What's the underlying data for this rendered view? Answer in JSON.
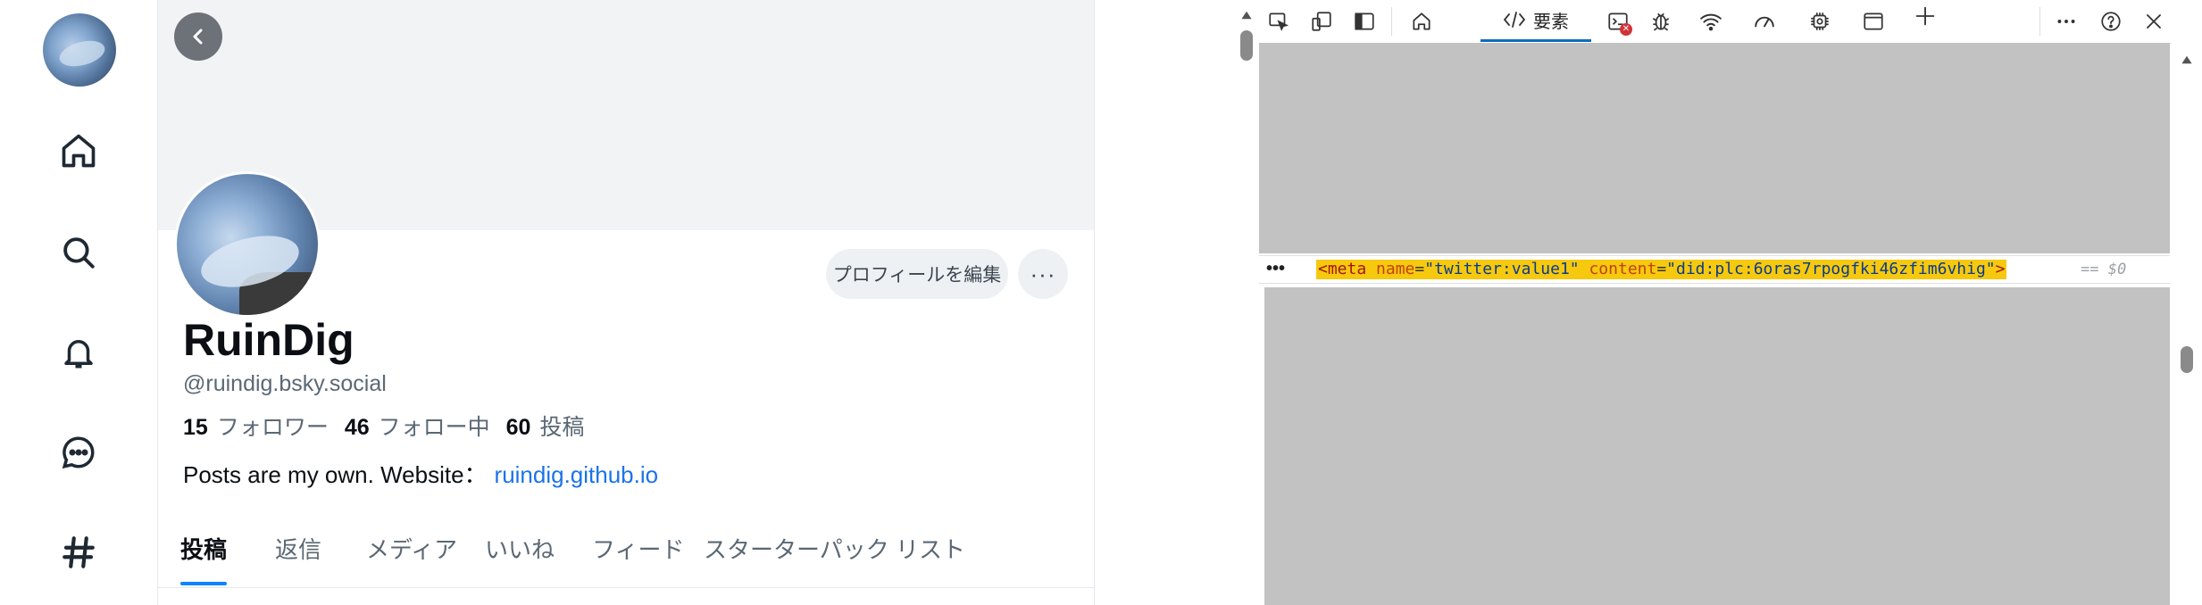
{
  "profile": {
    "display_name": "RuinDig",
    "handle": "@ruindig.bsky.social",
    "followers_count": "15",
    "followers_label": "フォロワー",
    "following_count": "46",
    "following_label": "フォロー中",
    "posts_count": "60",
    "posts_label": "投稿",
    "bio_text": "Posts are my own. Website：",
    "bio_link": "ruindig.github.io",
    "edit_button": "プロフィールを編集",
    "more_button": "···"
  },
  "tabs": [
    {
      "label": "投稿"
    },
    {
      "label": "返信"
    },
    {
      "label": "メディア"
    },
    {
      "label": "いいね"
    },
    {
      "label": "フィード"
    },
    {
      "label": "スターターパック"
    },
    {
      "label": "リスト"
    }
  ],
  "nav": {
    "icons": [
      "home-icon",
      "search-icon",
      "bell-icon",
      "chat-icon",
      "hash-icon"
    ]
  },
  "devtools": {
    "active_tab_label": "要素",
    "meta_open": "<meta",
    "attr1_name": "name",
    "attr1_value": "\"twitter:value1\"",
    "attr2_name": "content",
    "attr2_value": "\"did:plc:6oras7rpogfki46zfim6vhig\"",
    "meta_close": ">",
    "selected_marker": "== $0",
    "row_dots": "•••"
  },
  "colors": {
    "accent": "#1083fe",
    "link": "#1a73e8",
    "highlight": "#f6c90e",
    "devtools_gray": "#c2c2c2"
  }
}
